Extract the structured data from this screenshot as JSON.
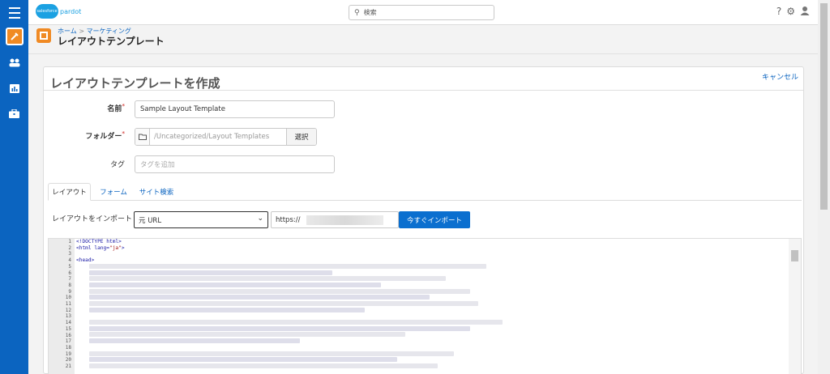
{
  "app": {
    "logo_brand": "salesforce",
    "logo_product": "pardot"
  },
  "topbar": {
    "search_placeholder": "検索",
    "help_icon": "question-icon",
    "settings_icon": "gear-icon",
    "user_icon": "user-icon"
  },
  "rail": {
    "items": [
      "menu-icon",
      "marketing-icon",
      "people-icon",
      "reports-icon",
      "admin-icon"
    ]
  },
  "header": {
    "breadcrumb_home": "ホーム",
    "breadcrumb_sep": ">",
    "breadcrumb_marketing": "マーケティング",
    "title": "レイアウトテンプレート"
  },
  "form": {
    "heading": "レイアウトテンプレートを作成",
    "cancel": "キャンセル",
    "name_label": "名前",
    "name_value": "Sample Layout Template",
    "folder_label": "フォルダー",
    "folder_value": "/Uncategorized/Layout Templates",
    "folder_select": "選択",
    "tag_label": "タグ",
    "tag_placeholder": "タグを追加",
    "required_mark": "*"
  },
  "tabs": [
    {
      "label": "レイアウト",
      "active": true
    },
    {
      "label": "フォーム",
      "active": false
    },
    {
      "label": "サイト検索",
      "active": false
    }
  ],
  "import": {
    "label": "レイアウトをインポート",
    "source_selected": "元 URL",
    "url_prefix": "https://",
    "button": "今すぐインポート"
  },
  "editor": {
    "line1": "<!DOCTYPE html>",
    "line2_a": "<html lang=",
    "line2_b": "\"ja\"",
    "line2_c": ">",
    "line4": "<head>",
    "line_numbers": [
      "1",
      "2",
      "3",
      "4",
      "5",
      "6",
      "7",
      "8",
      "9",
      "10",
      "11",
      "12",
      "13",
      "14",
      "15",
      "16",
      "17",
      "18",
      "19",
      "20",
      "21"
    ]
  }
}
